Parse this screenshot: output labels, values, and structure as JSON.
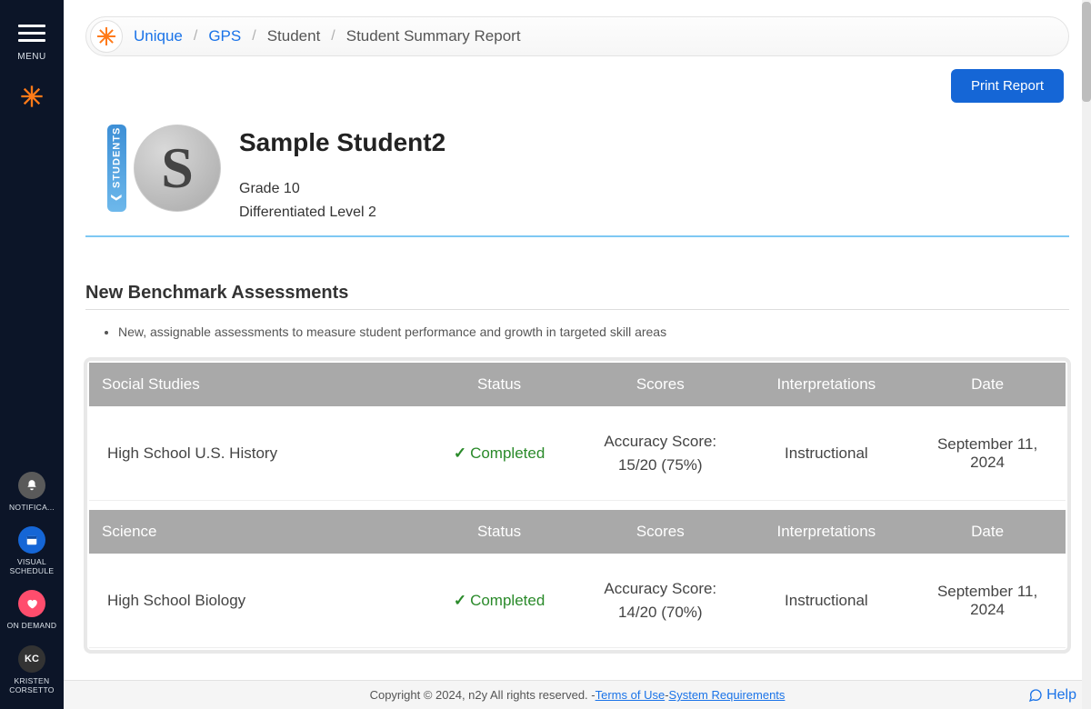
{
  "sidebar": {
    "menu_label": "MENU",
    "items": [
      {
        "label": "NOTIFICA...",
        "color": "#5a5a5a",
        "icon": "bell"
      },
      {
        "label": "VISUAL SCHEDULE",
        "color": "#1566d6",
        "icon": "calendar"
      },
      {
        "label": "ON DEMAND",
        "color": "#ff4d6d",
        "icon": "heart"
      },
      {
        "label": "KRISTEN CORSETTO",
        "color": "#333333",
        "icon": "KC"
      }
    ]
  },
  "breadcrumb": {
    "items": [
      "Unique",
      "GPS",
      "Student",
      "Student Summary Report"
    ]
  },
  "actions": {
    "print_label": "Print Report"
  },
  "student": {
    "tab_label": "STUDENTS",
    "initial": "S",
    "name": "Sample Student2",
    "grade": "Grade 10",
    "level": "Differentiated Level 2"
  },
  "section": {
    "title": "New Benchmark Assessments",
    "desc": "New, assignable assessments to measure student performance and growth in targeted skill areas"
  },
  "tables": [
    {
      "subject": "Social Studies",
      "headers": [
        "Status",
        "Scores",
        "Interpretations",
        "Date"
      ],
      "row": {
        "name": "High School U.S. History",
        "status": "Completed",
        "score_label": "Accuracy Score:",
        "score_value": "15/20 (75%)",
        "interpretation": "Instructional",
        "date": "September 11, 2024"
      }
    },
    {
      "subject": "Science",
      "headers": [
        "Status",
        "Scores",
        "Interpretations",
        "Date"
      ],
      "row": {
        "name": "High School Biology",
        "status": "Completed",
        "score_label": "Accuracy Score:",
        "score_value": "14/20 (70%)",
        "interpretation": "Instructional",
        "date": "September 11, 2024"
      }
    }
  ],
  "footer": {
    "copyright": "Copyright © 2024, n2y All rights reserved. - ",
    "terms": "Terms of Use",
    "sep": " - ",
    "sysreq": "System Requirements",
    "help": "Help"
  }
}
